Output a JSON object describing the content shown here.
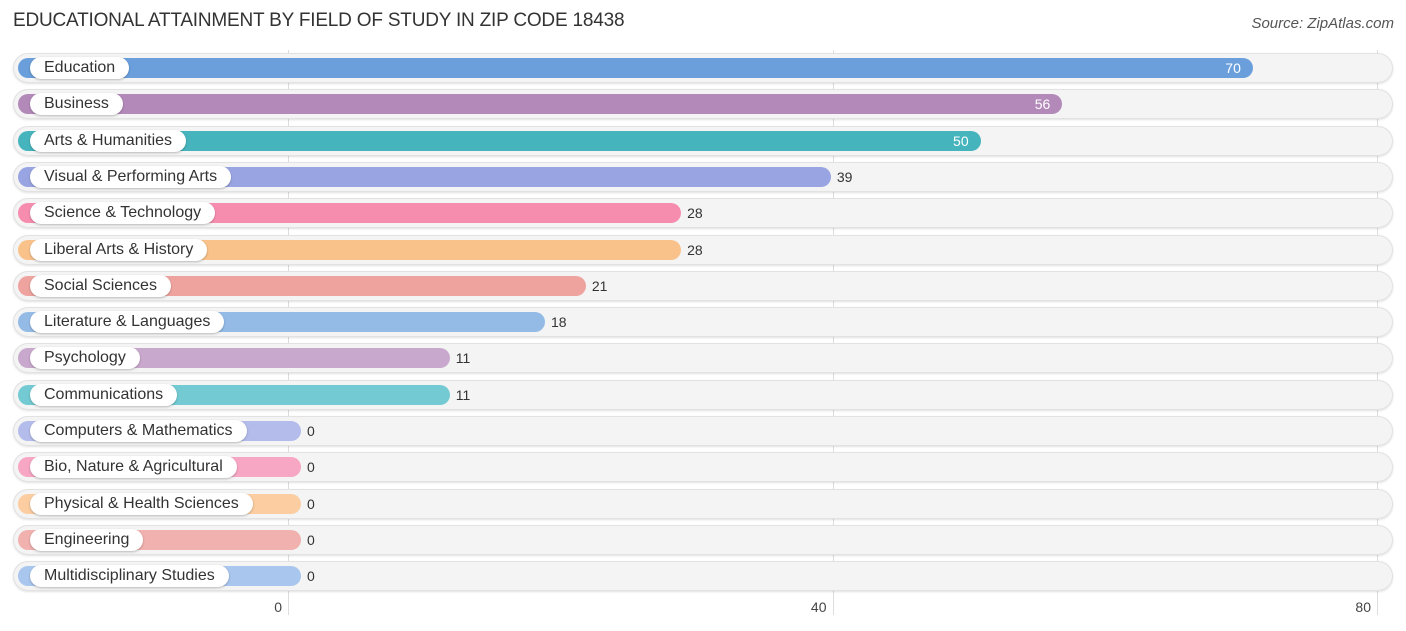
{
  "header": {
    "title": "EDUCATIONAL ATTAINMENT BY FIELD OF STUDY IN ZIP CODE 18438",
    "source": "Source: ZipAtlas.com"
  },
  "chart_data": {
    "type": "bar",
    "orientation": "horizontal",
    "title": "EDUCATIONAL ATTAINMENT BY FIELD OF STUDY IN ZIP CODE 18438",
    "source": "Source: ZipAtlas.com",
    "xlabel": "",
    "ylabel": "",
    "xlim": [
      0,
      80
    ],
    "x_ticks": [
      0,
      40,
      80
    ],
    "grid": true,
    "legend": "none",
    "categories": [
      "Education",
      "Business",
      "Arts & Humanities",
      "Visual & Performing Arts",
      "Science & Technology",
      "Liberal Arts & History",
      "Social Sciences",
      "Literature & Languages",
      "Psychology",
      "Communications",
      "Computers & Mathematics",
      "Bio, Nature & Agricultural",
      "Physical & Health Sciences",
      "Engineering",
      "Multidisciplinary Studies"
    ],
    "values": [
      70,
      56,
      50,
      39,
      28,
      28,
      21,
      18,
      11,
      11,
      0,
      0,
      0,
      0,
      0
    ],
    "colors": [
      "#6a9fdc",
      "#b389ba",
      "#45b4bd",
      "#99a5e2",
      "#f68daf",
      "#f9c28a",
      "#eea39f",
      "#94bbe6",
      "#c9a8cd",
      "#73cad2",
      "#b4bcec",
      "#f7a6c3",
      "#fbcda0",
      "#f1b1ae",
      "#a9c6ee"
    ]
  }
}
